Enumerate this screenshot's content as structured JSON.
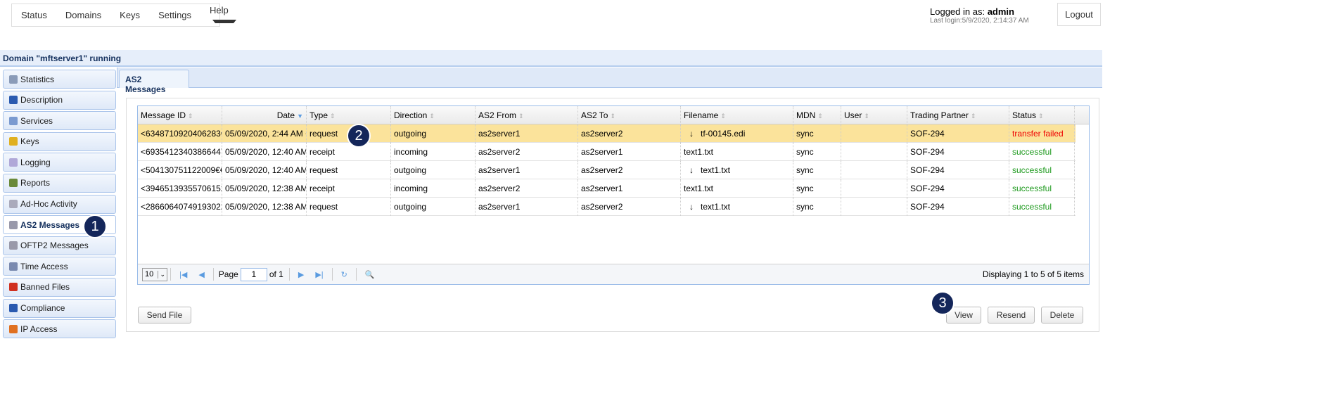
{
  "nav": {
    "items": [
      "Status",
      "Domains",
      "Keys",
      "Settings",
      "Help"
    ]
  },
  "user": {
    "label": "Logged in as: ",
    "name": "admin",
    "last_login": "Last login:5/9/2020, 2:14:37 AM",
    "logout": "Logout"
  },
  "domain_title": "Domain \"mftserver1\" running",
  "sidebar": {
    "items": [
      {
        "label": "Statistics",
        "icon": "statistics-icon",
        "color": "#8a9bb8"
      },
      {
        "label": "Description",
        "icon": "person-icon",
        "color": "#2a5ab0"
      },
      {
        "label": "Services",
        "icon": "services-icon",
        "color": "#7a9ad0"
      },
      {
        "label": "Keys",
        "icon": "key-icon",
        "color": "#e0b020"
      },
      {
        "label": "Logging",
        "icon": "speech-bubble-icon",
        "color": "#b0a8d8"
      },
      {
        "label": "Reports",
        "icon": "bar-chart-icon",
        "color": "#6a8a3a"
      },
      {
        "label": "Ad-Hoc Activity",
        "icon": "envelope-icon",
        "color": "#aab"
      },
      {
        "label": "AS2 Messages",
        "icon": "messages-icon",
        "color": "#99a"
      },
      {
        "label": "OFTP2 Messages",
        "icon": "messages-icon",
        "color": "#99a"
      },
      {
        "label": "Time Access",
        "icon": "clock-icon",
        "color": "#7a8ab0"
      },
      {
        "label": "Banned Files",
        "icon": "banned-icon",
        "color": "#d03020"
      },
      {
        "label": "Compliance",
        "icon": "person-icon",
        "color": "#2a5ab0"
      },
      {
        "label": "IP Access",
        "icon": "firewall-icon",
        "color": "#e07020"
      }
    ],
    "active": "AS2 Messages"
  },
  "tab": "AS2 Messages",
  "table": {
    "columns": [
      "Message ID",
      "Date",
      "Type",
      "Direction",
      "AS2 From",
      "AS2 To",
      "Filename",
      "MDN",
      "User",
      "Trading Partner",
      "Status"
    ],
    "rows": [
      [
        "<6348710920406283€",
        "05/09/2020, 2:44 AM +",
        "request",
        "outgoing",
        "as2server1",
        "as2server2",
        "tf-00145.edi",
        "sync",
        "",
        "SOF-294",
        "transfer failed"
      ],
      [
        "<69354123403866447",
        "05/09/2020, 12:40 AM",
        "receipt",
        "incoming",
        "as2server2",
        "as2server1",
        "text1.txt",
        "sync",
        "",
        "SOF-294",
        "successful"
      ],
      [
        "<504130751122009€€",
        "05/09/2020, 12:40 AM",
        "request",
        "outgoing",
        "as2server1",
        "as2server2",
        "text1.txt",
        "sync",
        "",
        "SOF-294",
        "successful"
      ],
      [
        "<394651393557061522",
        "05/09/2020, 12:38 AM",
        "receipt",
        "incoming",
        "as2server2",
        "as2server1",
        "text1.txt",
        "sync",
        "",
        "SOF-294",
        "successful"
      ],
      [
        "<286606407491930222",
        "05/09/2020, 12:38 AM",
        "request",
        "outgoing",
        "as2server1",
        "as2server2",
        "text1.txt",
        "sync",
        "",
        "SOF-294",
        "successful"
      ]
    ],
    "outgoing_arrow": "↓"
  },
  "pager": {
    "page_size": "10",
    "page_label": "Page",
    "page": "1",
    "of": "of 1",
    "display": "Displaying 1 to 5 of 5 items"
  },
  "buttons": {
    "send_file": "Send File",
    "view": "View",
    "resend": "Resend",
    "delete": "Delete"
  },
  "callouts": [
    "1",
    "2",
    "3"
  ],
  "colors": {
    "selected_row": "#fbe39b",
    "success": "#1e9a1e",
    "fail": "#e00000",
    "callout": "#14265a"
  }
}
